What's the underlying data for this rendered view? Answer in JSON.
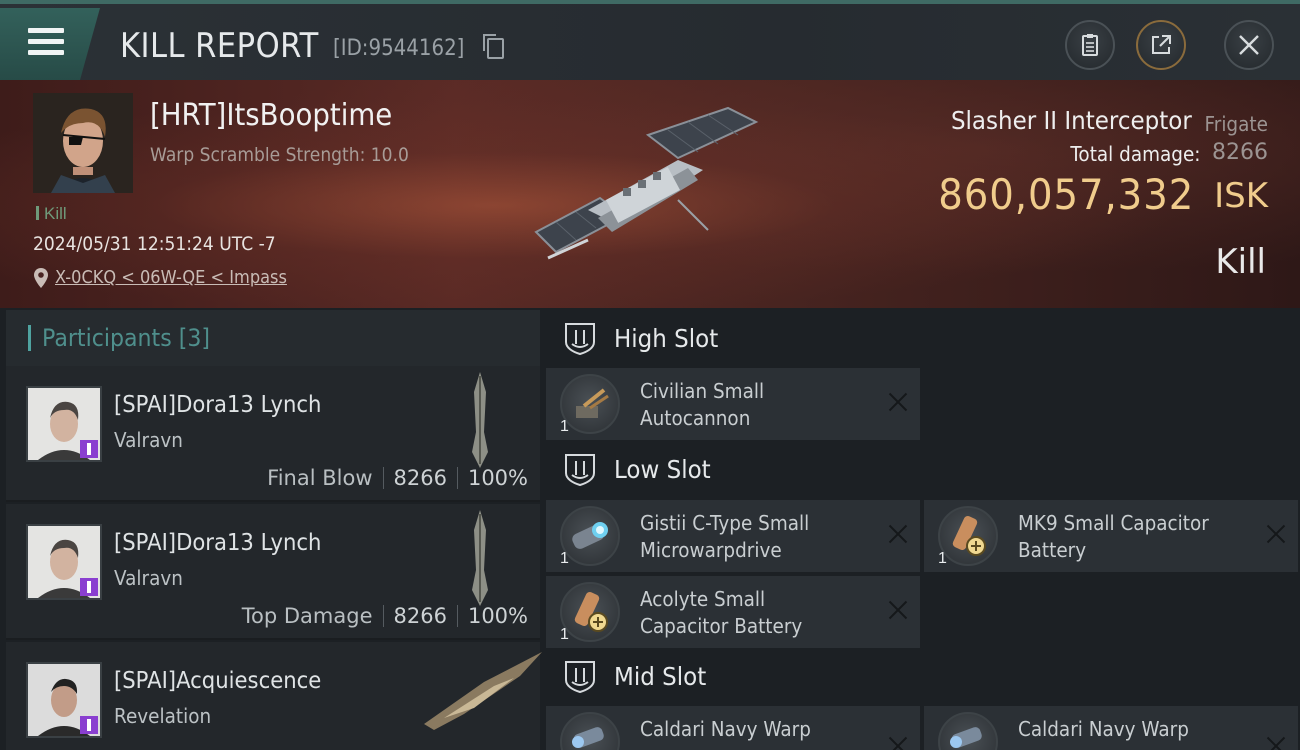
{
  "header": {
    "title": "KILL REPORT",
    "kill_id": "[ID:9544162]"
  },
  "victim": {
    "name": "[HRT]ItsBooptime",
    "warp_scramble": "Warp Scramble Strength: 10.0",
    "kill_tag": "Kill",
    "timestamp": "2024/05/31 12:51:24 UTC -7",
    "location": "X-0CKQ < 06W-QE < Impass",
    "ship_name": "Slasher II Interceptor",
    "ship_class": "Frigate",
    "total_damage_label": "Total damage:",
    "total_damage": "8266",
    "isk_value": "860,057,332",
    "isk_unit": "ISK",
    "result": "Kill"
  },
  "participants": {
    "title": "Participants",
    "count": "[3]",
    "items": [
      {
        "name": "[SPAI]Dora13 Lynch",
        "ship": "Valravn",
        "label": "Final Blow",
        "damage": "8266",
        "percent": "100%"
      },
      {
        "name": "[SPAI]Dora13 Lynch",
        "ship": "Valravn",
        "label": "Top Damage",
        "damage": "8266",
        "percent": "100%"
      },
      {
        "name": "[SPAI]Acquiescence",
        "ship": "Revelation"
      }
    ]
  },
  "fittings": {
    "high_slot": {
      "title": "High Slot",
      "modules": [
        {
          "name": "Civilian Small Autocannon",
          "qty": "1",
          "icon": "autocannon-icon"
        }
      ]
    },
    "low_slot": {
      "title": "Low Slot",
      "modules": [
        {
          "name": "Gistii C-Type Small Microwarpdrive",
          "qty": "1",
          "icon": "microwarpdrive-icon"
        },
        {
          "name": "MK9 Small Capacitor Battery",
          "qty": "1",
          "icon": "capacitor-battery-icon"
        },
        {
          "name": "Acolyte Small Capacitor Battery",
          "qty": "1",
          "icon": "capacitor-battery-icon"
        }
      ]
    },
    "mid_slot": {
      "title": "Mid Slot",
      "modules": [
        {
          "name": "Caldari Navy Warp",
          "icon": "warp-module-icon"
        },
        {
          "name": "Caldari Navy Warp",
          "icon": "warp-module-icon"
        }
      ]
    }
  },
  "colors": {
    "accent_teal": "#4fa3a0",
    "isk_gold": "#f0cc8c",
    "banner_red": "#5a2a25",
    "badge_purple": "#8a3fd0"
  },
  "icons": [
    "menu-icon",
    "copy-icon",
    "clipboard-icon",
    "export-icon",
    "close-icon",
    "location-pin-icon",
    "slot-shield-icon",
    "remove-x-icon"
  ]
}
